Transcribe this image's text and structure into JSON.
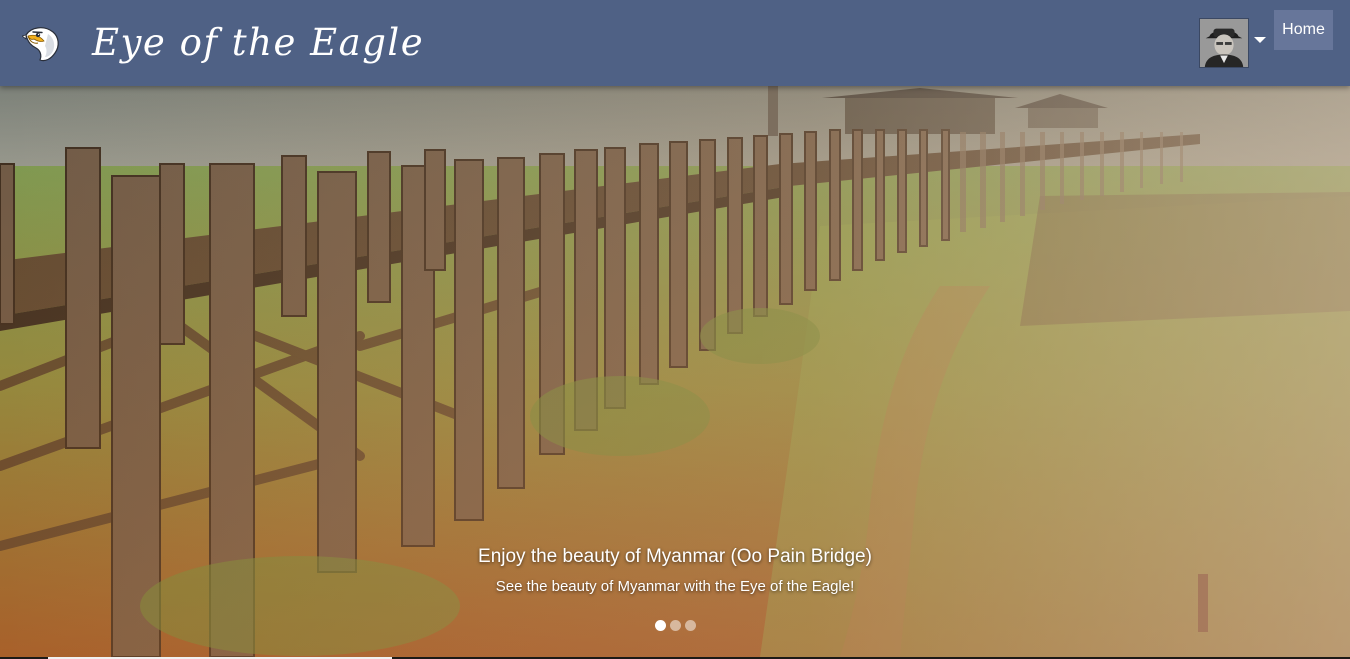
{
  "header": {
    "brand_title": "Eye of the Eagle",
    "logo_icon": "eagle-head-icon",
    "avatar_icon": "user-avatar-icon",
    "dropdown_icon": "caret-down-icon",
    "home_label": "Home",
    "bar_color": "#4f6185",
    "button_color": "#67769a"
  },
  "carousel": {
    "slide_image": "wooden-bridge-field-photo",
    "caption_title": "Enjoy the beauty of Myanmar (Oo Pain Bridge)",
    "caption_text": "See the beauty of Myanmar with the Eye of the Eagle!",
    "slide_count": 3,
    "active_slide": 1
  }
}
